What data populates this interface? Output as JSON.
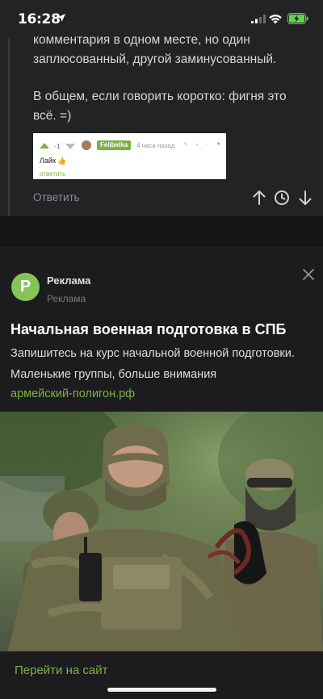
{
  "status_bar": {
    "time": "16:28",
    "battery_color": "#63d04f"
  },
  "comment": {
    "line1": "комментария в одном месте, но один заплюсованный, другой заминусованный.",
    "line2": "В общем, если говорить коротко: фигня это всё. =)",
    "embed": {
      "score": "-1",
      "username": "Felibelka",
      "time_ago": "4 часа назад",
      "body": "Лайк 👍",
      "reply_link": "ответить"
    },
    "reply_label": "Ответить",
    "icons": [
      "arrow-up-icon",
      "clock-icon",
      "arrow-down-icon"
    ]
  },
  "ad": {
    "logo_letter": "P",
    "advertiser": "Реклама",
    "advertiser_sub": "Реклама",
    "title": "Начальная военная подготовка в СПБ",
    "description": "Запишитесь на курс начальной военной подготовки. Маленькие группы, больше внимания",
    "domain": "армейский-полигон.рф",
    "cta": "Перейти на сайт",
    "accent_color": "#7bb245"
  }
}
